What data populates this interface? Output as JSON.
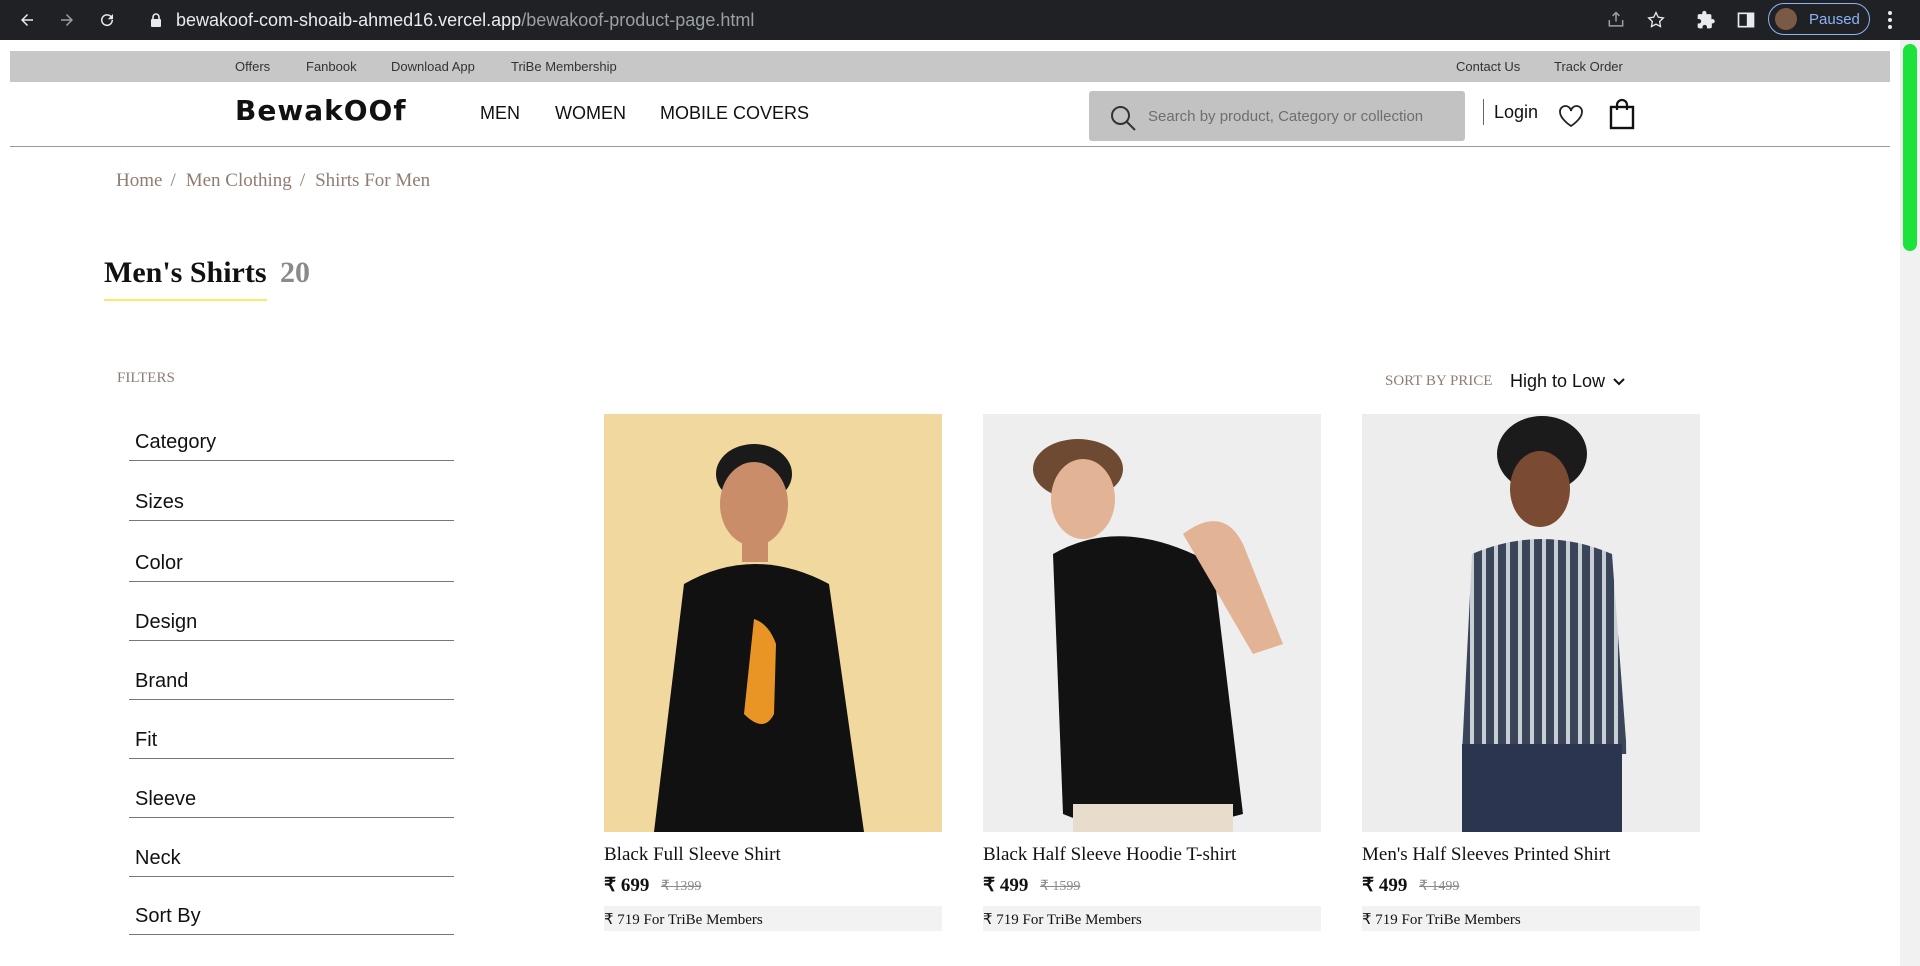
{
  "browser": {
    "url_host": "bewakoof-com-shoaib-ahmed16.vercel.app",
    "url_path": "/bewakoof-product-page.html",
    "profile_status": "Paused"
  },
  "topstrip": {
    "left": [
      "Offers",
      "Fanbook",
      "Download App",
      "TriBe Membership"
    ],
    "right": [
      "Contact Us",
      "Track Order"
    ]
  },
  "header": {
    "logo": "BewakOOf",
    "nav": [
      "MEN",
      "WOMEN",
      "MOBILE COVERS"
    ],
    "search_placeholder": "Search by product, Category or collection",
    "login": "Login"
  },
  "breadcrumb": [
    "Home",
    "Men Clothing",
    "Shirts For Men"
  ],
  "page_title": "Men's Shirts",
  "product_count": "20",
  "filters": {
    "label": "FILTERS",
    "items": [
      "Category",
      "Sizes",
      "Color",
      "Design",
      "Brand",
      "Fit",
      "Sleeve",
      "Neck",
      "Sort By"
    ]
  },
  "sort": {
    "label": "SORT BY PRICE",
    "value": "High to Low"
  },
  "products": [
    {
      "name": "Black Full Sleeve Shirt",
      "price": "₹ 699",
      "mrp": "₹ 1399",
      "tribe": "₹ 719 For TriBe Members",
      "bg": "#f0d89e"
    },
    {
      "name": "Black Half Sleeve Hoodie T-shirt",
      "price": "₹ 499",
      "mrp": "₹ 1599",
      "tribe": "₹ 719 For TriBe Members",
      "bg": "#eeeeee"
    },
    {
      "name": "Men's Half Sleeves Printed Shirt",
      "price": "₹ 499",
      "mrp": "₹ 1499",
      "tribe": "₹ 719 For TriBe Members",
      "bg": "#ededed"
    }
  ]
}
